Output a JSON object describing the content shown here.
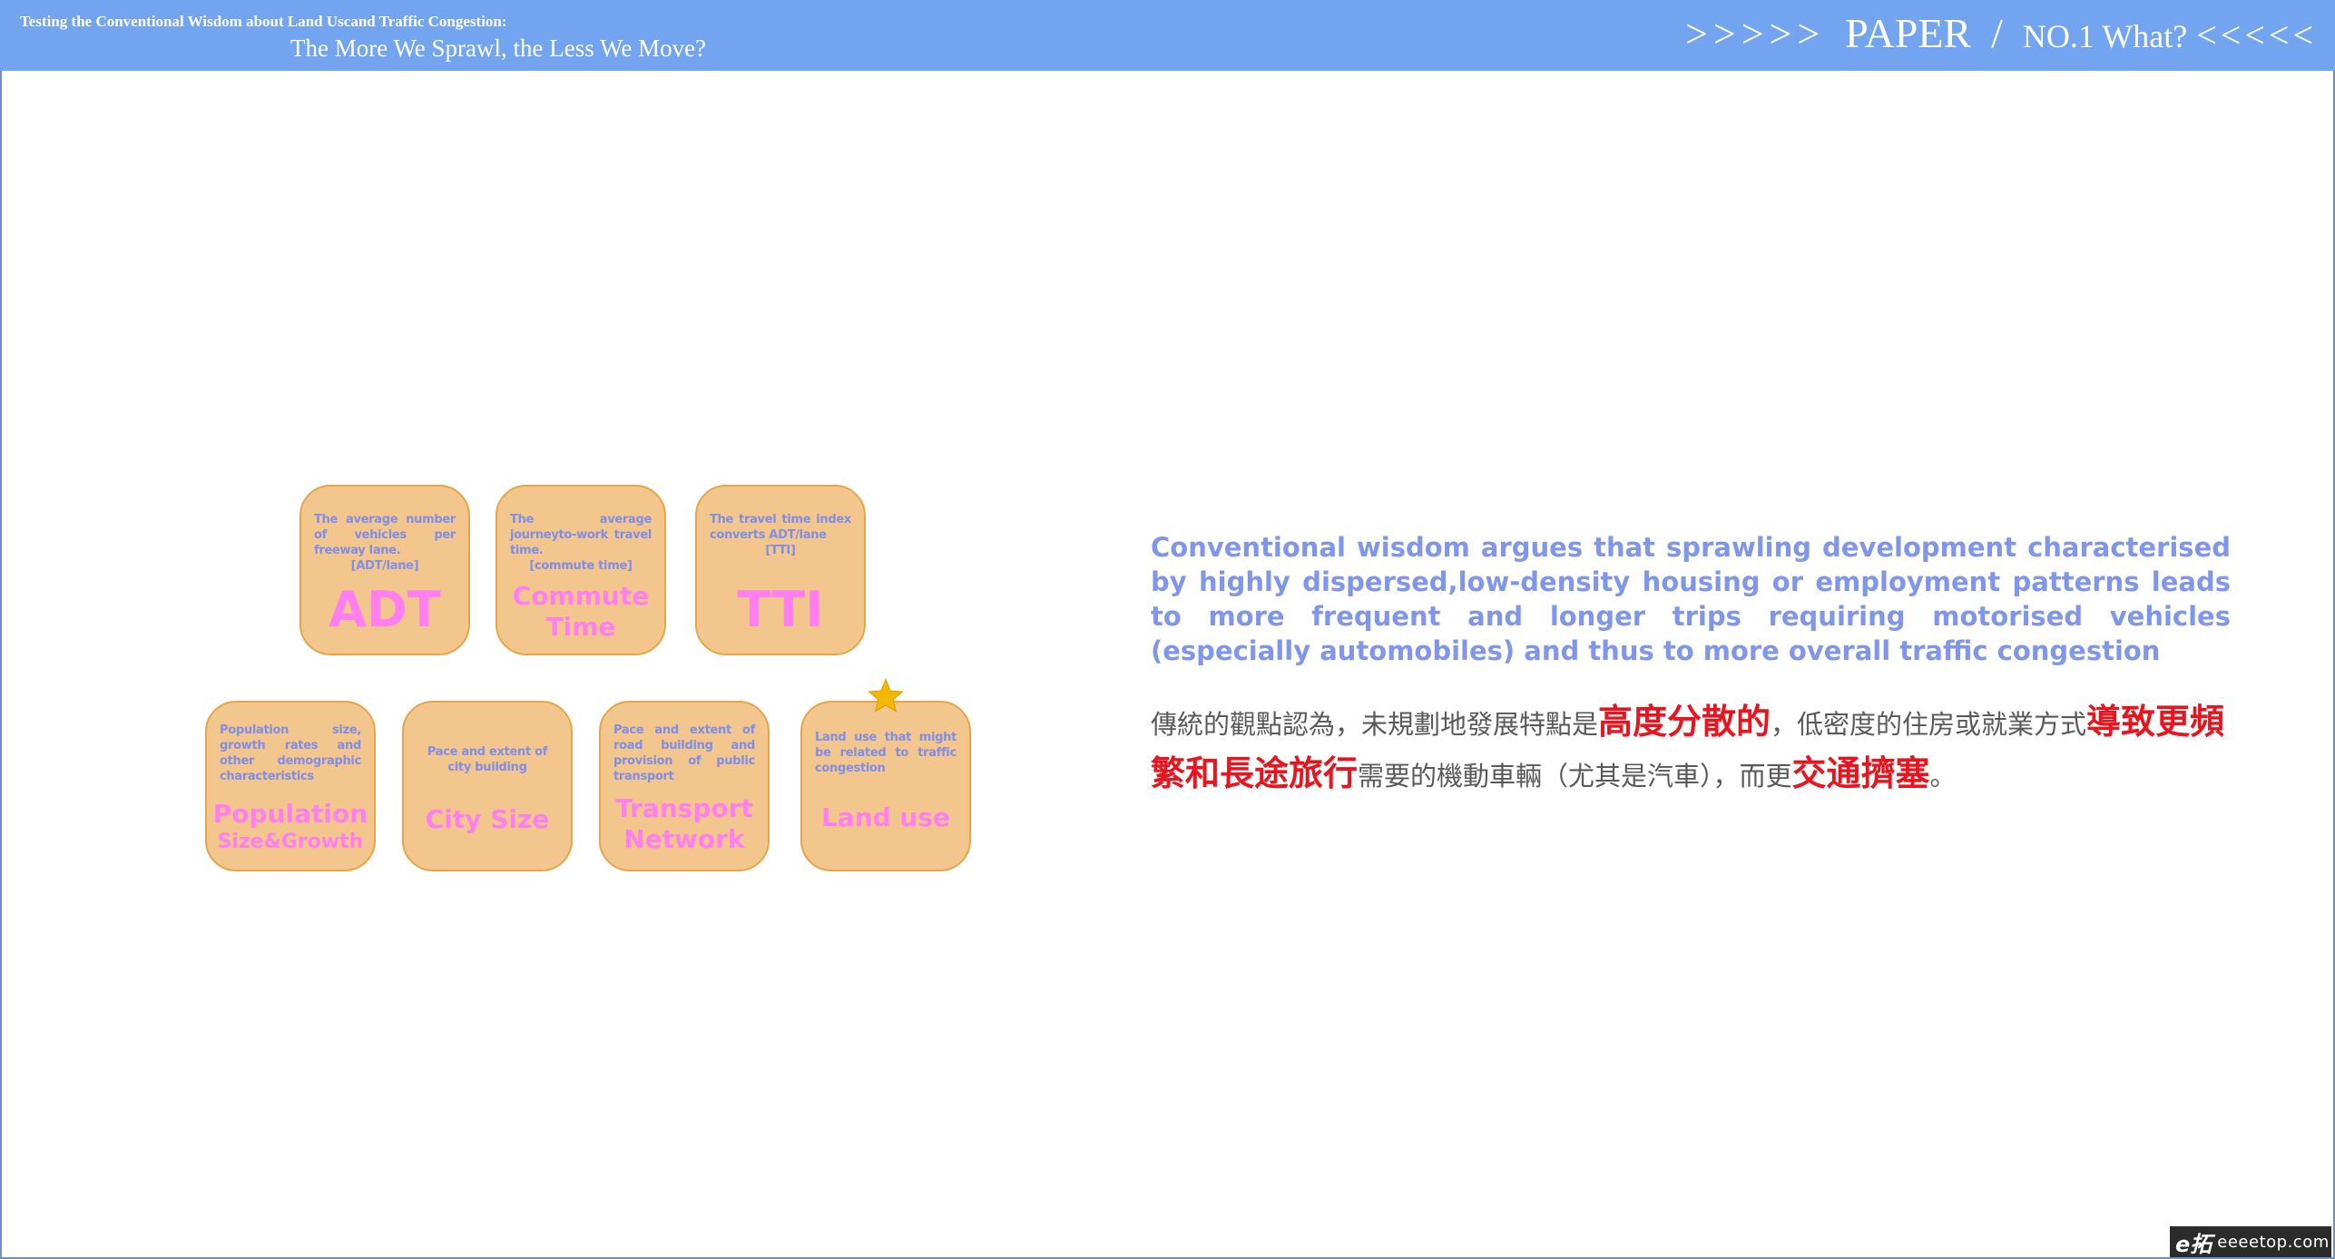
{
  "header": {
    "title_line1": "Testing the Conventional Wisdom about Land Uscand Traffic Congestion:",
    "title_line2": "The More We Sprawl, the Less We Move?",
    "arrows_left": ">>>>>",
    "paper": "PAPER",
    "slash": "/",
    "section": "NO.1 What?",
    "arrows_right": "<<<<<"
  },
  "cards": {
    "adt": {
      "desc": "The average number of vehicles per freeway lane.",
      "tag": "[ADT/lane]",
      "label": "ADT"
    },
    "commute": {
      "desc": "The average journeyto-work travel time.",
      "tag": "[commute time]",
      "label_line1": "Commute",
      "label_line2": "Time"
    },
    "tti": {
      "desc": "The travel time index converts ADT/lane",
      "tag": "[TTI]",
      "label": "TTI"
    },
    "population": {
      "desc": "Population size, growth rates and other demographic characteristics",
      "label_line1": "Population",
      "label_line2": "Size&Growth"
    },
    "city_size": {
      "desc": "Pace and extent of city building",
      "label": "City Size"
    },
    "transport": {
      "desc": "Pace and extent of road building and provision of public transport",
      "label_line1": "Transport",
      "label_line2": "Network"
    },
    "land_use": {
      "desc": "Land use that might be related to traffic congestion",
      "label": "Land use"
    }
  },
  "colors": {
    "card_fill": "#f2c68c",
    "card_border": "#e6a54a",
    "label_pink": "#ff7ff0",
    "desc_blue": "#7f8ee8",
    "highlight_red": "#e8141e",
    "star": "#f5b800"
  },
  "icons": {
    "star": "star-icon"
  },
  "english_text": "Conventional wisdom argues that sprawling development characterised by highly dispersed,low-density housing or employment patterns leads to more frequent and longer trips requiring motorised vehicles (especially automobiles) and thus to more overall traffic congestion",
  "chinese_text": {
    "part1": "傳統的觀點認為，未規劃地發展特點是",
    "hl1": "高度分散的",
    "part2": "，低密度的住房或就業方式",
    "hl2": "導致更頻繁和長途旅行",
    "part3": "需要的機動車輛（尤其是汽車），而更",
    "hl3": "交通擠塞",
    "part4": "。"
  },
  "watermark": {
    "logo": "e拓",
    "text": "eeeetop.com"
  }
}
